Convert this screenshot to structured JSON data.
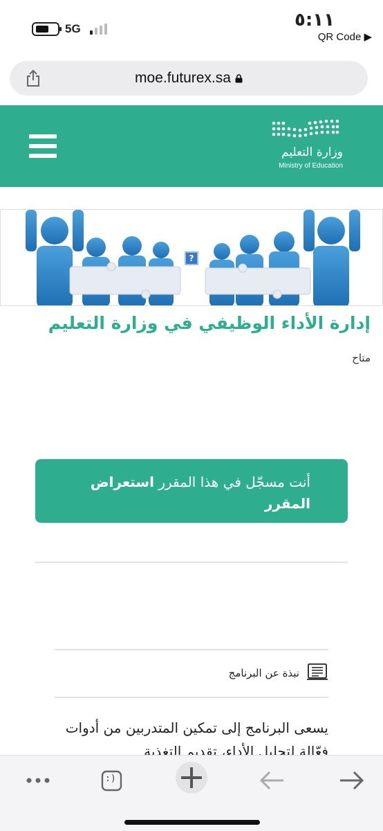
{
  "status_bar": {
    "network": "5G",
    "time": "٥:١١",
    "back_app": "QR Code ▶"
  },
  "browser": {
    "url": "moe.futurex.sa"
  },
  "header": {
    "logo_ar": "وزارة التعليم",
    "logo_en": "Ministry of Education",
    "brand_color": "#2fae8f"
  },
  "banner": {
    "broken_image_glyph": "?"
  },
  "course": {
    "title": "إدارة الأداء الوظيفي في وزارة التعليم",
    "availability": "متاح"
  },
  "enrollment": {
    "text": "أنت مسجّل في هذا المقرر",
    "link": "استعراض المقرر"
  },
  "about": {
    "label": "نبذة عن البرنامج",
    "description": "يسعى البرنامج إلى تمكين المتدربين من أدوات فعّالة لتحليل الأداء، تقديم التغذية"
  },
  "toolbar": {
    "tabs_glyph": ":)",
    "icons": [
      "more-icon",
      "tabs-icon",
      "new-tab-icon",
      "back-icon",
      "forward-icon"
    ]
  }
}
